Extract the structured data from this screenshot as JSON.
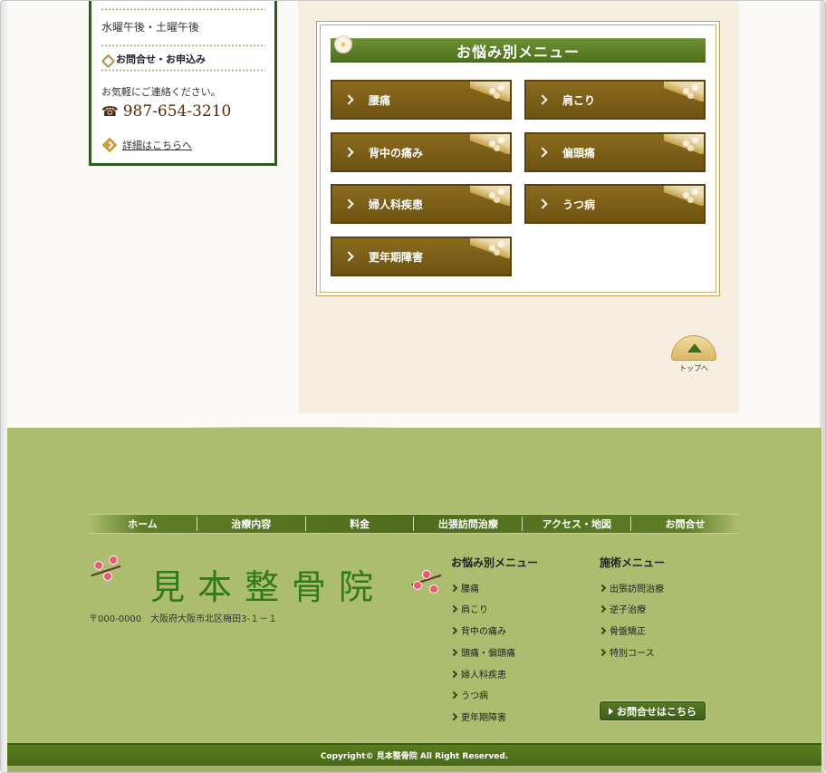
{
  "sidebar": {
    "hours": "水曜午後・土曜午後",
    "contact_heading": "お問合せ・お申込み",
    "message": "お気軽にご連絡ください。",
    "phone": "987-654-3210",
    "details_link": "詳細はこちらへ"
  },
  "concerns_menu": {
    "title": "お悩み別メニュー",
    "items": [
      {
        "label": "腰痛"
      },
      {
        "label": "肩こり"
      },
      {
        "label": "背中の痛み"
      },
      {
        "label": "偏頭痛"
      },
      {
        "label": "婦人科疾患"
      },
      {
        "label": "うつ病"
      },
      {
        "label": "更年期障害"
      }
    ]
  },
  "to_top": {
    "label": "トップへ"
  },
  "footer": {
    "nav": [
      {
        "label": "ホーム"
      },
      {
        "label": "治療内容"
      },
      {
        "label": "料金"
      },
      {
        "label": "出張訪問治療"
      },
      {
        "label": "アクセス・地図"
      },
      {
        "label": "お問合せ"
      }
    ],
    "logo_text": "見本整骨院",
    "address": "〒000-0000　大阪府大阪市北区梅田3-１－１",
    "concerns_title": "お悩み別メニュー",
    "concerns_links": [
      {
        "label": "腰痛"
      },
      {
        "label": "肩こり"
      },
      {
        "label": "背中の痛み"
      },
      {
        "label": "頭痛・偏頭痛"
      },
      {
        "label": "婦人科疾患"
      },
      {
        "label": "うつ病"
      },
      {
        "label": "更年期障害"
      }
    ],
    "treatment_title": "施術メニュー",
    "treatment_links": [
      {
        "label": "出張訪問治療"
      },
      {
        "label": "逆子治療"
      },
      {
        "label": "骨盤矯正"
      },
      {
        "label": "特別コース"
      }
    ],
    "contact_button": "お問合せはこちら",
    "copyright": "Copyright© 見本整骨院 All Right Reserved."
  },
  "colors": {
    "accent_green": "#4e6c1c",
    "menu_brown": "#7a5d18",
    "footer_green": "#acbd6f"
  }
}
